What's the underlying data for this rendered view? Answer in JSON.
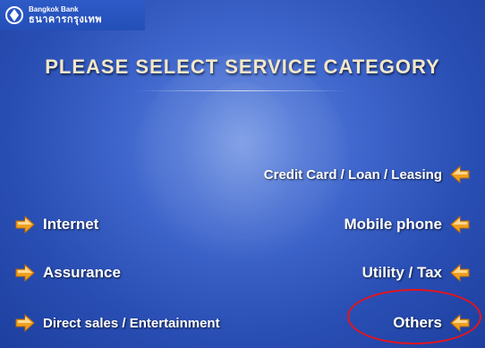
{
  "bank": {
    "name_en": "Bangkok Bank",
    "name_th": "ธนาคารกรุงเทพ",
    "logo_icon": "bangkok-bank-logo-icon"
  },
  "screen": {
    "title": "PLEASE SELECT SERVICE CATEGORY"
  },
  "options": {
    "credit_card": "Credit Card / Loan / Leasing",
    "internet": "Internet",
    "mobile_phone": "Mobile phone",
    "assurance": "Assurance",
    "utility_tax": "Utility / Tax",
    "direct_sales": "Direct sales / Entertainment",
    "others": "Others"
  },
  "colors": {
    "background": "#2a4fb5",
    "title_text": "#f2e7c8",
    "arrow_orange": "#f0a020",
    "annotation_red": "#e8131b"
  },
  "annotation": {
    "highlighted_option": "Others"
  }
}
